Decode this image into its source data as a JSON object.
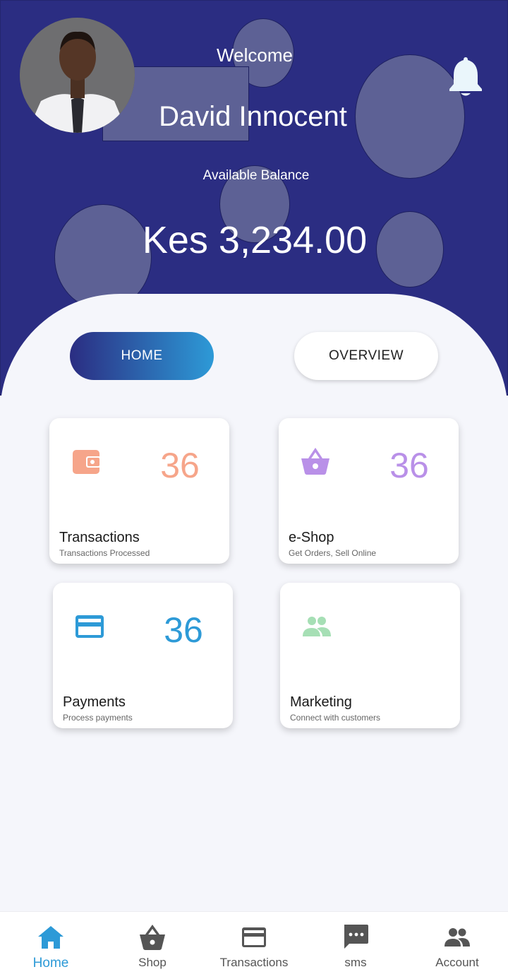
{
  "header": {
    "welcome_text": "Welcome",
    "user_name": "David Innocent",
    "balance_label": "Available Balance",
    "balance_value": "Kes 3,234.00",
    "notification_icon": "bell-icon"
  },
  "tabs": {
    "home_label": "HOME",
    "overview_label": "OVERVIEW"
  },
  "cards": [
    {
      "icon": "wallet-icon",
      "count": "36",
      "title": "Transactions",
      "subtitle": "Transactions Processed",
      "color": "#f6a58a"
    },
    {
      "icon": "basket-icon",
      "count": "36",
      "title": "e-Shop",
      "subtitle": "Get Orders, Sell Online",
      "color": "#b990e8"
    },
    {
      "icon": "credit-card-icon",
      "count": "36",
      "title": "Payments",
      "subtitle": "Process payments",
      "color": "#2d9ad7"
    },
    {
      "icon": "people-icon",
      "count": "",
      "title": "Marketing",
      "subtitle": "Connect with customers",
      "color": "#a6dfb5"
    }
  ],
  "bottom_nav": [
    {
      "icon": "home-icon",
      "label": "Home",
      "active": true
    },
    {
      "icon": "basket-icon",
      "label": "Shop",
      "active": false
    },
    {
      "icon": "credit-card-icon",
      "label": "Transactions",
      "active": false
    },
    {
      "icon": "chat-icon",
      "label": "sms",
      "active": false
    },
    {
      "icon": "people-icon",
      "label": "Account",
      "active": false
    }
  ],
  "colors": {
    "header_bg": "#2b2d82",
    "accent": "#2d9ad7",
    "page_bg": "#f5f6fb"
  }
}
